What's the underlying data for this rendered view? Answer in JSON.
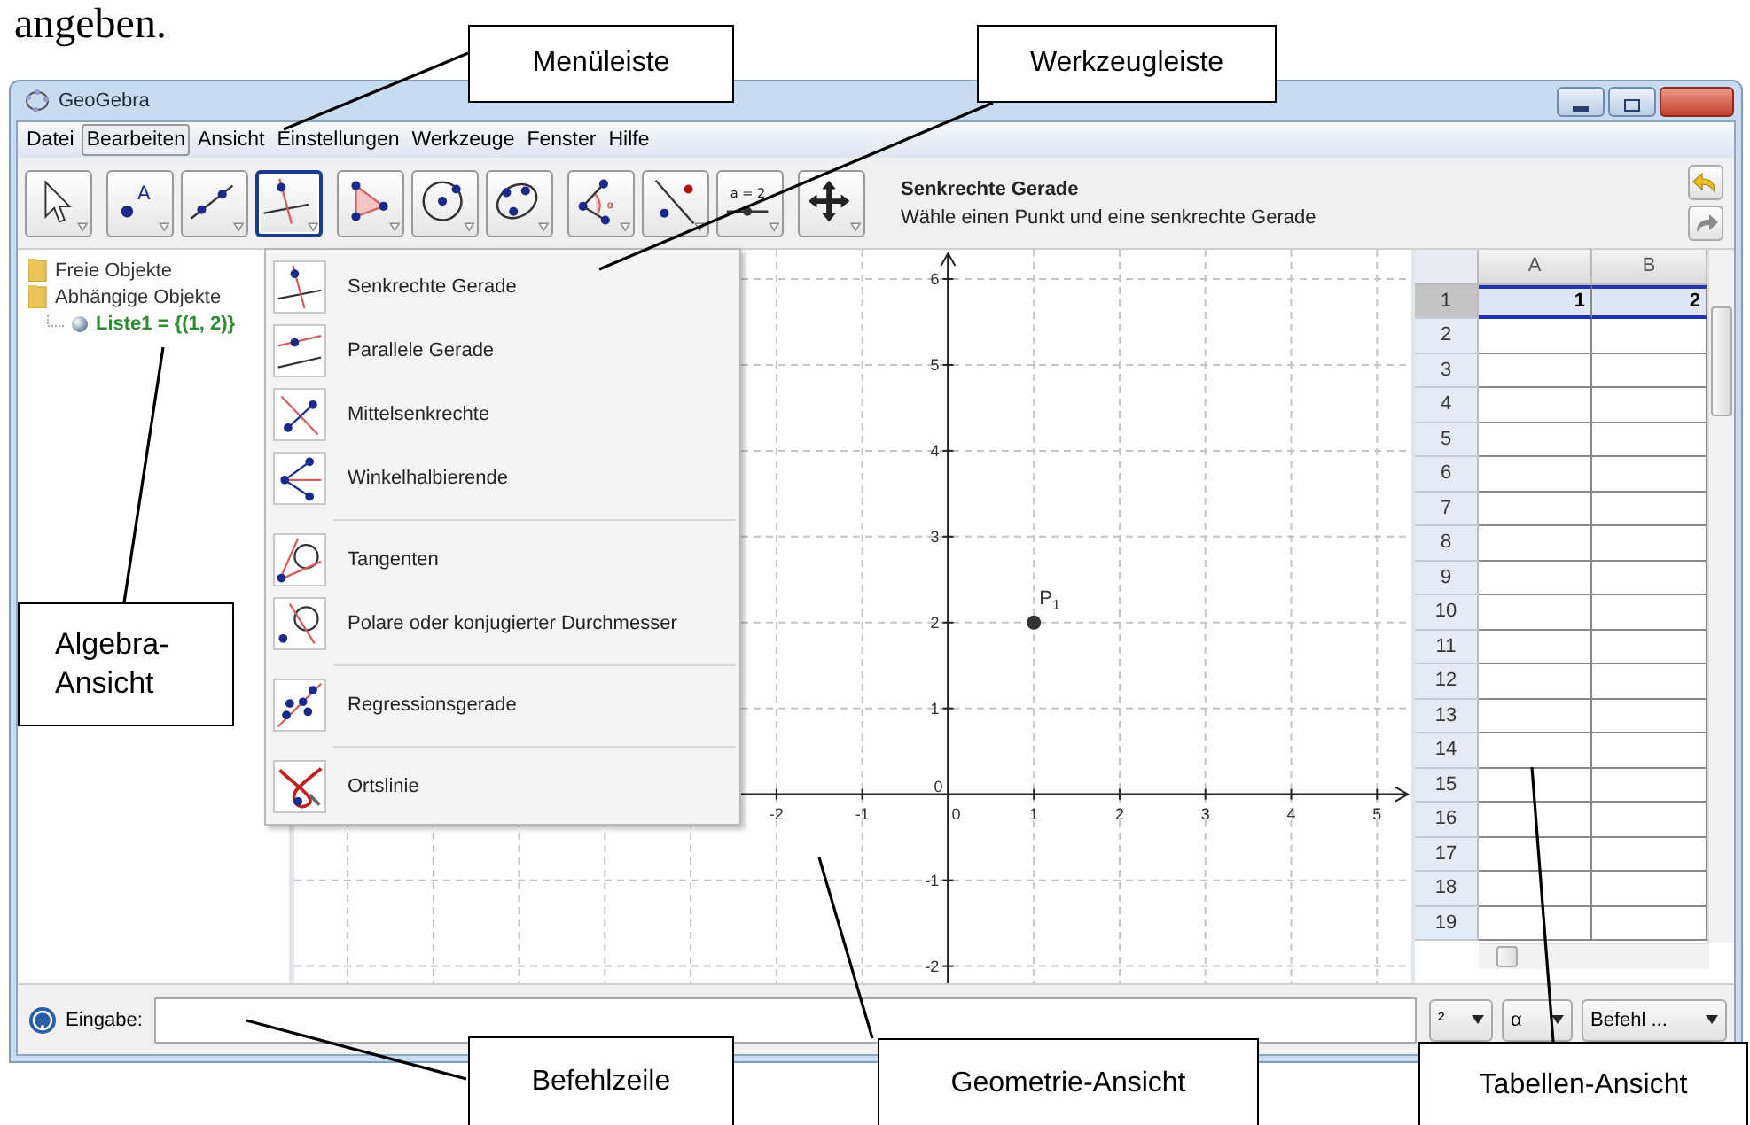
{
  "document_text": "angeben.",
  "window": {
    "title": "GeoGebra"
  },
  "menu_bar": [
    {
      "label": "Datei",
      "selected": false
    },
    {
      "label": "Bearbeiten",
      "selected": true
    },
    {
      "label": "Ansicht",
      "selected": false
    },
    {
      "label": "Einstellungen",
      "selected": false
    },
    {
      "label": "Werkzeuge",
      "selected": false
    },
    {
      "label": "Fenster",
      "selected": false
    },
    {
      "label": "Hilfe",
      "selected": false
    }
  ],
  "tool_groups": [
    {
      "tools": [
        {
          "kind": "move",
          "selected": false
        }
      ]
    },
    {
      "tools": [
        {
          "kind": "point",
          "selected": false,
          "glyph": "A"
        },
        {
          "kind": "line",
          "selected": false
        },
        {
          "kind": "perpendicular",
          "selected": true
        }
      ]
    },
    {
      "tools": [
        {
          "kind": "polygon",
          "selected": false
        },
        {
          "kind": "circle",
          "selected": false
        },
        {
          "kind": "conic",
          "selected": false
        }
      ]
    },
    {
      "tools": [
        {
          "kind": "angle",
          "selected": false,
          "glyph": "α"
        },
        {
          "kind": "reflect",
          "selected": false
        },
        {
          "kind": "slider",
          "selected": false,
          "glyph": "a = 2"
        }
      ]
    },
    {
      "tools": [
        {
          "kind": "move-view",
          "selected": false
        }
      ]
    }
  ],
  "tool_info": {
    "name": "Senkrechte Gerade",
    "description": "Wähle einen Punkt und eine senkrechte Gerade"
  },
  "algebra_view": [
    {
      "kind": "folder",
      "label": "Freie Objekte"
    },
    {
      "kind": "folder",
      "label": "Abhängige Objekte",
      "children": [
        {
          "kind": "object",
          "label": "Liste1 = {(1, 2)}"
        }
      ]
    }
  ],
  "tool_menu": {
    "groups": [
      {
        "items": [
          {
            "kind": "perpendicular",
            "label": "Senkrechte Gerade"
          },
          {
            "kind": "parallel",
            "label": "Parallele Gerade"
          },
          {
            "kind": "bisector",
            "label": "Mittelsenkrechte"
          },
          {
            "kind": "angle-bisector",
            "label": "Winkelhalbierende"
          }
        ]
      },
      {
        "items": [
          {
            "kind": "tangents",
            "label": "Tangenten"
          },
          {
            "kind": "polar",
            "label": "Polare oder konjugierter Durchmesser"
          }
        ]
      },
      {
        "items": [
          {
            "kind": "regression",
            "label": "Regressionsgerade"
          }
        ]
      },
      {
        "items": [
          {
            "kind": "locus",
            "label": "Ortslinie"
          }
        ]
      }
    ]
  },
  "graphics_view": {
    "chart_data": {
      "type": "scatter",
      "grid": true,
      "x": [
        1
      ],
      "series": [
        {
          "name": "P$_{1}$",
          "color": "#333333",
          "values": [
            2
          ]
        }
      ],
      "xlim": [
        -7.62,
        5.4
      ],
      "ylim": [
        -2.2,
        6.34
      ],
      "xticks": [
        -2,
        -1,
        0,
        1,
        2,
        3,
        4,
        5
      ],
      "yticks": [
        -2,
        -1,
        0,
        1,
        2,
        3,
        4,
        5,
        6
      ]
    }
  },
  "spreadsheet": {
    "columns": [
      "A",
      "B"
    ],
    "rows": [
      {
        "header": "1",
        "selected": true,
        "cells": [
          "1",
          "2"
        ]
      },
      {
        "header": "2",
        "selected": false
      },
      {
        "header": "3",
        "selected": false
      },
      {
        "header": "4",
        "selected": false
      },
      {
        "header": "5",
        "selected": false
      },
      {
        "header": "6",
        "selected": false
      },
      {
        "header": "7",
        "selected": false
      },
      {
        "header": "8",
        "selected": false
      },
      {
        "header": "9",
        "selected": false
      },
      {
        "header": "10",
        "selected": false
      },
      {
        "header": "11",
        "selected": false
      },
      {
        "header": "12",
        "selected": false
      },
      {
        "header": "13",
        "selected": false
      },
      {
        "header": "14",
        "selected": false
      },
      {
        "header": "15",
        "selected": false
      },
      {
        "header": "16",
        "selected": false
      },
      {
        "header": "17",
        "selected": false
      },
      {
        "header": "18",
        "selected": false
      },
      {
        "header": "19",
        "selected": false
      }
    ]
  },
  "input_bar": {
    "label": "Eingabe:",
    "dropdowns": [
      "²",
      "α",
      "Befehl ..."
    ]
  },
  "callouts": [
    {
      "text": "Menüleiste"
    },
    {
      "text": "Werkzeugleiste"
    },
    {
      "text": "Algebra-Ansicht"
    },
    {
      "text": "Befehlzeile"
    },
    {
      "text": "Geometrie-Ansicht"
    },
    {
      "text": "Tabellen-Ansicht"
    }
  ]
}
